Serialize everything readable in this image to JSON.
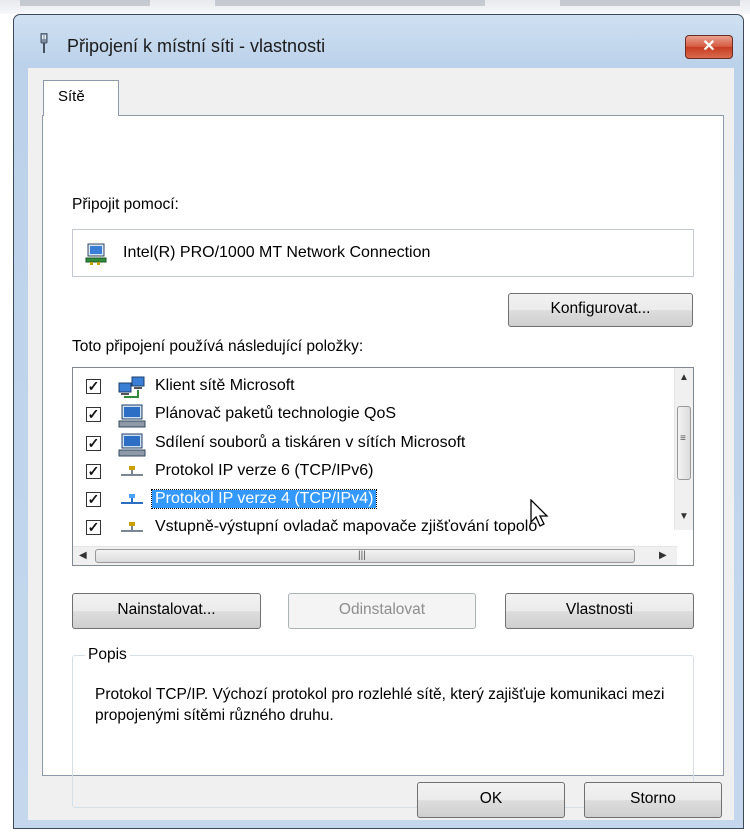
{
  "window": {
    "title": "Připojení k místní síti - vlastnosti",
    "close_label": "✕"
  },
  "tabs": [
    {
      "label": "Sítě",
      "active": true
    }
  ],
  "connect_using": {
    "label": "Připojit pomocí:",
    "device": "Intel(R) PRO/1000 MT Network Connection",
    "configure_button": "Konfigurovat..."
  },
  "items": {
    "label": "Toto připojení používá následující položky:",
    "list": [
      {
        "label": "Klient sítě Microsoft",
        "checked": true,
        "icon": "network-client-icon",
        "selected": false
      },
      {
        "label": "Plánovač paketů technologie QoS",
        "checked": true,
        "icon": "network-service-icon",
        "selected": false
      },
      {
        "label": "Sdílení souborů a tiskáren v sítích Microsoft",
        "checked": true,
        "icon": "network-service-icon",
        "selected": false
      },
      {
        "label": "Protokol IP verze 6 (TCP/IPv6)",
        "checked": true,
        "icon": "network-protocol-icon",
        "selected": false
      },
      {
        "label": "Protokol IP verze 4 (TCP/IPv4)",
        "checked": true,
        "icon": "network-protocol-icon",
        "selected": true
      },
      {
        "label": "Vstupně-výstupní ovladač mapovače zjišťování topolo",
        "checked": true,
        "icon": "network-protocol-icon",
        "selected": false
      }
    ]
  },
  "buttons": {
    "install": "Nainstalovat...",
    "uninstall": "Odinstalovat",
    "properties": "Vlastnosti",
    "ok": "OK",
    "cancel": "Storno"
  },
  "description": {
    "title": "Popis",
    "text": "Protokol TCP/IP. Výchozí protokol pro rozlehlé sítě, který zajišťuje komunikaci mezi propojenými sítěmi různého druhu."
  },
  "colors": {
    "selection": "#3399ff",
    "titlebar": "#bcd2ea",
    "close": "#c73c22"
  }
}
